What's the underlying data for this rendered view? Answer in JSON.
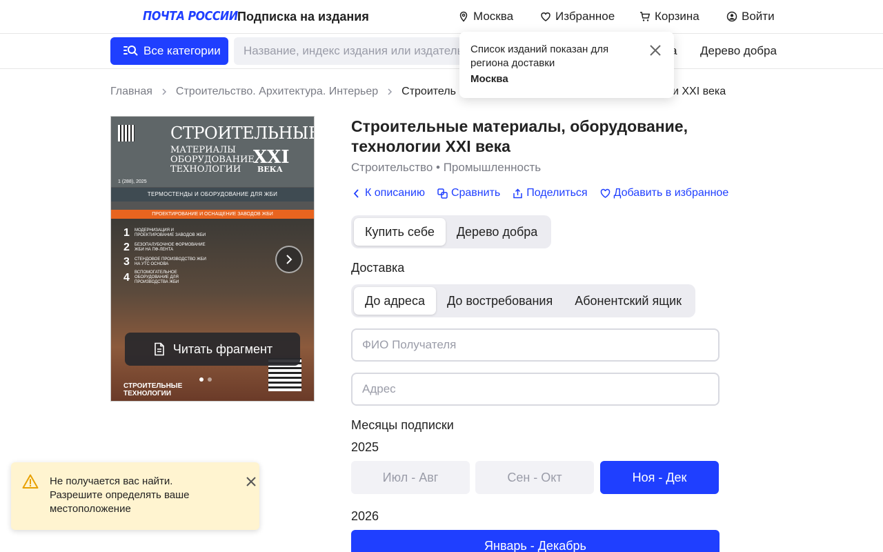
{
  "header": {
    "logo": "ПОЧТА РОССИИ",
    "title": "Подписка на издания",
    "location": "Москва",
    "favorites": "Избранное",
    "cart": "Корзина",
    "login": "Войти"
  },
  "nav": {
    "categories_button": "Все категории",
    "search_placeholder": "Название, индекс издания или издатель",
    "link_partial": "а",
    "charity": "Дерево добра"
  },
  "popover": {
    "text": "Список изданий показан для региона доставки",
    "city": "Москва"
  },
  "breadcrumb": {
    "home": "Главная",
    "category": "Строительство. Архитектура. Интерьер",
    "current_start": "Строитель",
    "current_end": "и XXI века"
  },
  "cover": {
    "title": "СТРОИТЕЛЬНЫЕ",
    "subtitle_1": "МАТЕРИАЛЫ",
    "subtitle_2": "ОБОРУДОВАНИЕ",
    "subtitle_3": "ТЕХНОЛОГИИ",
    "xxi": "XXI",
    "vek": "ВЕКА",
    "issue": "1 (288), 2025",
    "band1": "ТЕРМОСТЕНДЫ И ОБОРУДОВАНИЕ ДЛЯ ЖБИ",
    "band2": "ПРОЕКТИРОВАНИЕ И ОСНАЩЕНИЕ ЗАВОДОВ ЖБИ",
    "items": [
      {
        "num": "1",
        "text": "МОДЕРНИЗАЦИЯ И ПРОЕКТИРОВАНИЕ ЗАВОДОВ ЖБИ"
      },
      {
        "num": "2",
        "text": "БЕЗОПАЛУБОЧНОЕ ФОРМОВАНИЕ ЖБИ НА ПФ-ЛЕНТА"
      },
      {
        "num": "3",
        "text": "СТЕНДОВОЕ ПРОИЗВОДСТВО ЖБИ НА УТС ОСНОВА"
      },
      {
        "num": "4",
        "text": "ВСПОМОГАТЕЛЬНОЕ ОБОРУДОВАНИЕ ДЛЯ ПРОИЗВОДСТВА ЖБИ"
      }
    ],
    "bottom_1": "СТРОИТЕЛЬНЫЕ",
    "bottom_2": "ТЕХНОЛОГИИ",
    "read_fragment": "Читать фрагмент"
  },
  "product": {
    "title": "Строительные материалы, оборудование, технологии XXI века",
    "category": "Строительство • Промышленность",
    "actions": {
      "back": "К описанию",
      "compare": "Сравнить",
      "share": "Поделиться",
      "favorite": "Добавить в избранное"
    },
    "buy_modes": [
      "Купить себе",
      "Дерево добра"
    ],
    "delivery_label": "Доставка",
    "delivery_modes": [
      "До адреса",
      "До востребования",
      "Абонентский ящик"
    ],
    "recipient_placeholder": "ФИО Получателя",
    "address_placeholder": "Адрес",
    "months_label": "Месяцы подписки",
    "year_2025": "2025",
    "months_2025": [
      "Июл - Авг",
      "Сен - Окт",
      "Ноя - Дек"
    ],
    "year_2026": "2026",
    "months_2026": "Январь - Декабрь"
  },
  "toast": {
    "text": "Не получается вас найти. Разрешите определять ваше местоположение"
  },
  "colors": {
    "accent": "#1f3fff",
    "toast_bg": "#fff4d0"
  }
}
